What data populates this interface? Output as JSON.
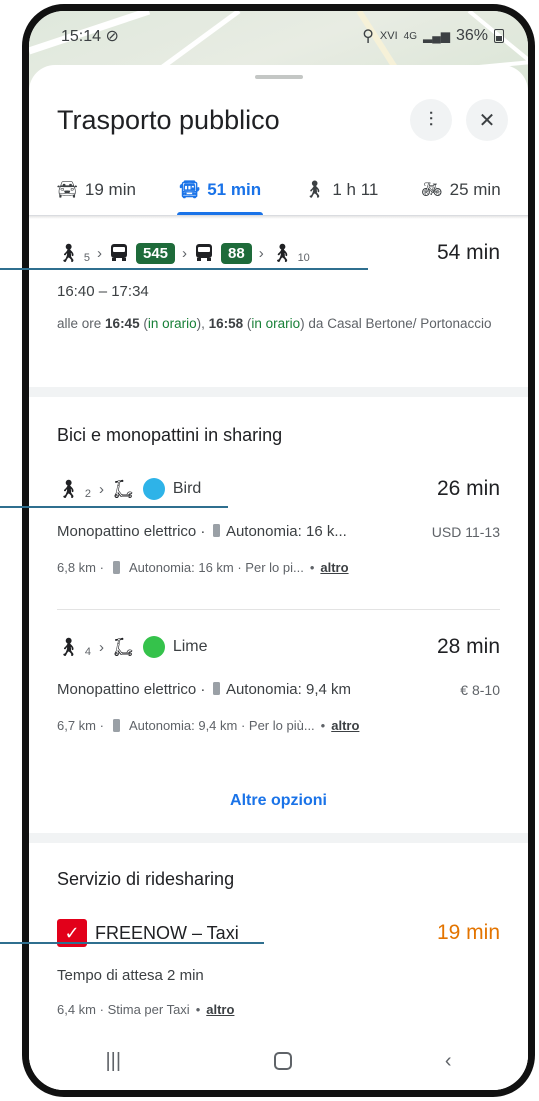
{
  "status": {
    "time": "15:14",
    "battery": "36%",
    "carrier": "XVI",
    "network": "4G"
  },
  "header": {
    "title": "Trasporto pubblico"
  },
  "tabs": [
    {
      "label": "19 min",
      "icon": "car-icon"
    },
    {
      "label": "51 min",
      "icon": "bus-icon",
      "active": true
    },
    {
      "label": "1 h 11",
      "icon": "walk-icon"
    },
    {
      "label": "25 min",
      "icon": "bike-icon"
    }
  ],
  "route": {
    "walk_start": "5",
    "bus1": "545",
    "bus2": "88",
    "walk_end": "10",
    "duration": "54 min",
    "times": "16:40 – 17:34",
    "detail_prefix": "alle ore",
    "time1": "16:45",
    "status1": "in orario",
    "time2": "16:58",
    "status2": "in orario",
    "detail_suffix": "da Casal Bertone/ Portonaccio"
  },
  "sharing": {
    "title": "Bici e monopattini in sharing",
    "items": [
      {
        "walk": "2",
        "provider": "Bird",
        "duration": "26 min",
        "desc_a": "Monopattino elettrico ·",
        "desc_b": "Autonomia: 16 k...",
        "price": "USD 11-13",
        "meta_a": "6,8 km ·",
        "meta_b": "Autonomia: 16 km · Per lo pi...",
        "more": "altro"
      },
      {
        "walk": "4",
        "provider": "Lime",
        "duration": "28 min",
        "desc_a": "Monopattino elettrico ·",
        "desc_b": "Autonomia: 9,4 km",
        "price": "€ 8-10",
        "meta_a": "6,7 km ·",
        "meta_b": "Autonomia: 9,4 km · Per lo più...",
        "more": "altro"
      }
    ],
    "more_options": "Altre opzioni"
  },
  "ridesharing": {
    "title": "Servizio di ridesharing",
    "provider": "FREENOW – Taxi",
    "duration": "19 min",
    "wait": "Tempo di attesa 2 min",
    "meta": "6,4 km · Stima per Taxi",
    "more": "altro"
  },
  "colors": {
    "accent": "#1a73e8",
    "bus_badge": "#1e6b3a",
    "on_time": "#188038",
    "ride_duration": "#e37400",
    "freenow": "#e2001a",
    "lime": "#35c24b",
    "bird": "#2eb3e8"
  }
}
